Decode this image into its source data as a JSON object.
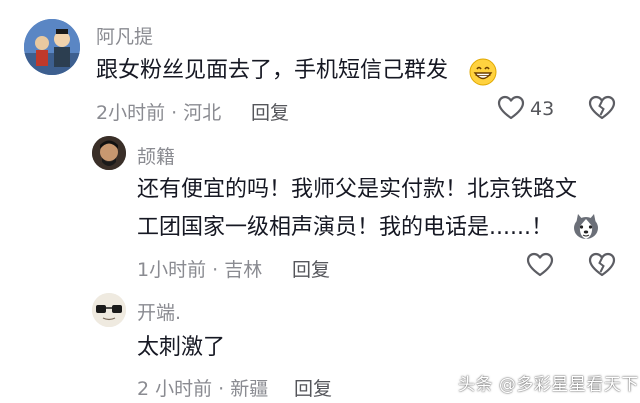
{
  "comments": [
    {
      "username": "阿凡提",
      "text": "跟女粉丝见面去了，手机短信己群发",
      "time_location": "2小时前 · 河北",
      "reply_label": "回复",
      "like_count": "43"
    },
    {
      "username": "颉籍",
      "text_line1": "还有便宜的吗！我师父是实付款！北京铁路文",
      "text_line2": "工团国家一级相声演员！我的电话是......！",
      "time_location": "1小时前 · 吉林",
      "reply_label": "回复"
    },
    {
      "username": "开端.",
      "text": "太刺激了",
      "time_location": "2 小时前 · 新疆",
      "reply_label": "回复"
    }
  ],
  "watermark": "头条 @多彩星星看天下",
  "colors": {
    "text": "#161823",
    "secondary": "#8a8b91",
    "icon": "#5c5d63"
  }
}
